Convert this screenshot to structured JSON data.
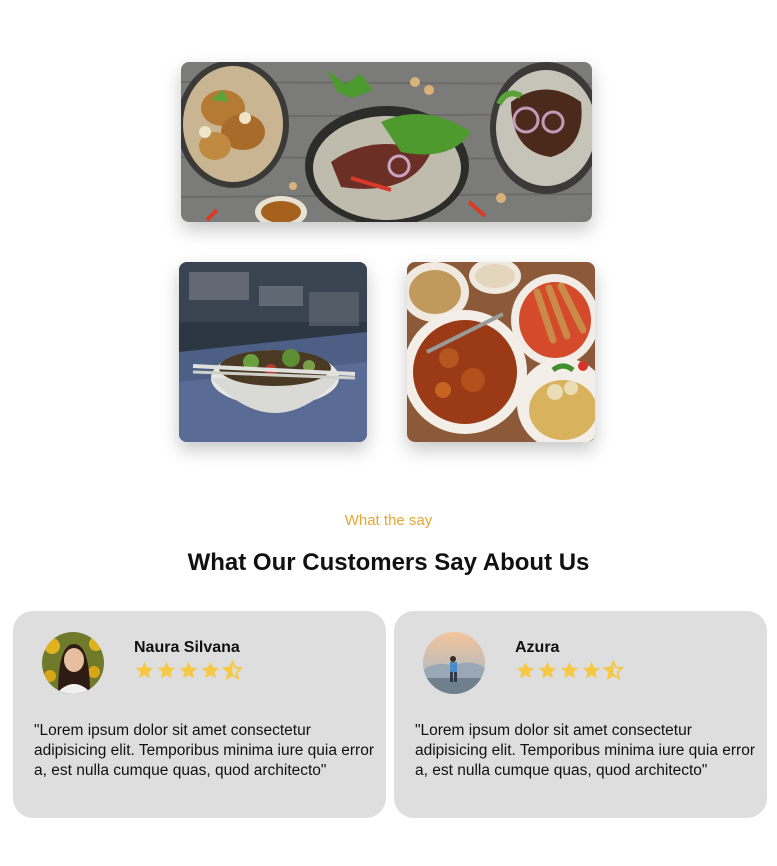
{
  "section": {
    "eyebrow": "What the say",
    "title": "What Our Customers Say About Us"
  },
  "gallery": [
    {
      "alt": "Table spread of grilled beef salad, fried rolls and cashews"
    },
    {
      "alt": "Bowl of noodle soup with chopsticks"
    },
    {
      "alt": "Plates of satay, fried chicken and noodles"
    }
  ],
  "testimonials": [
    {
      "name": "Naura Silvana",
      "rating": 4.5,
      "quote": "\"Lorem ipsum dolor sit amet consectetur adipisicing elit. Temporibus minima iure quia error a, est nulla cumque quas, quod architecto\""
    },
    {
      "name": "Azura",
      "rating": 4.5,
      "quote": "\"Lorem ipsum dolor sit amet consectetur adipisicing elit. Temporibus minima iure quia error a, est nulla cumque quas, quod architecto\""
    }
  ],
  "colors": {
    "accent": "#e8a634",
    "star": "#f7c843",
    "card_bg": "#dedede"
  },
  "icons": {
    "star_full": "star-icon",
    "star_half": "star-half-icon"
  }
}
